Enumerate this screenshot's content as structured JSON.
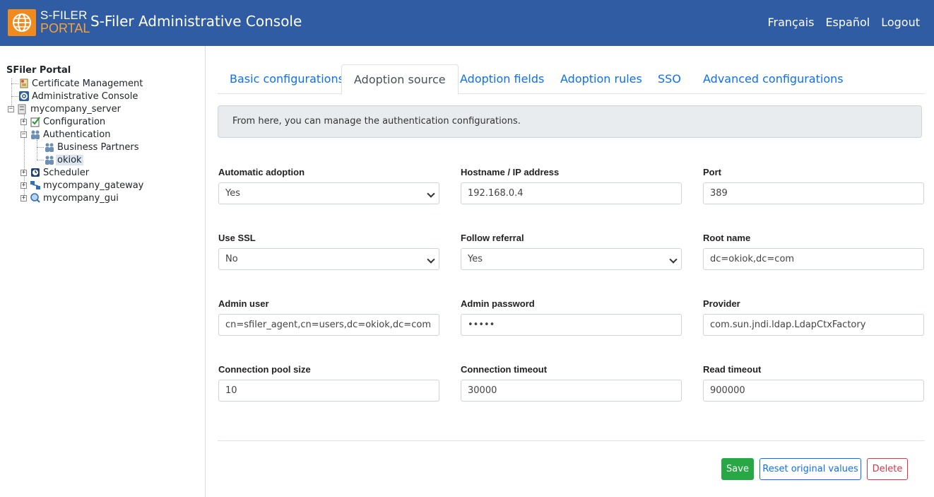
{
  "header": {
    "logo_line1": "S-FILER",
    "logo_line2": "PORTAL",
    "title": "S-Filer Administrative Console",
    "links": [
      "Français",
      "Español",
      "Logout"
    ]
  },
  "tree": {
    "root": "SFiler Portal",
    "items": [
      {
        "label": "Certificate Management"
      },
      {
        "label": "Administrative Console"
      },
      {
        "label": "mycompany_server"
      },
      {
        "label": "Configuration"
      },
      {
        "label": "Authentication"
      },
      {
        "label": "Business Partners"
      },
      {
        "label": "okiok"
      },
      {
        "label": "Scheduler"
      },
      {
        "label": "mycompany_gateway"
      },
      {
        "label": "mycompany_gui"
      }
    ]
  },
  "tabs": [
    {
      "label": "Basic configurations"
    },
    {
      "label": "Adoption source"
    },
    {
      "label": "Adoption fields"
    },
    {
      "label": "Adoption rules"
    },
    {
      "label": "SSO"
    },
    {
      "label": "Advanced configurations"
    }
  ],
  "info": "From here, you can manage the authentication configurations.",
  "form": {
    "automatic_adoption": {
      "label": "Automatic adoption",
      "value": "Yes"
    },
    "hostname": {
      "label": "Hostname / IP address",
      "value": "192.168.0.4"
    },
    "port": {
      "label": "Port",
      "value": "389"
    },
    "use_ssl": {
      "label": "Use SSL",
      "value": "No"
    },
    "follow_referral": {
      "label": "Follow referral",
      "value": "Yes"
    },
    "root_name": {
      "label": "Root name",
      "value": "dc=okiok,dc=com"
    },
    "admin_user": {
      "label": "Admin user",
      "value": "cn=sfiler_agent,cn=users,dc=okiok,dc=com"
    },
    "admin_password": {
      "label": "Admin password",
      "value": "•••••"
    },
    "provider": {
      "label": "Provider",
      "value": "com.sun.jndi.ldap.LdapCtxFactory"
    },
    "pool_size": {
      "label": "Connection pool size",
      "value": "10"
    },
    "conn_timeout": {
      "label": "Connection timeout",
      "value": "30000"
    },
    "read_timeout": {
      "label": "Read timeout",
      "value": "900000"
    }
  },
  "buttons": {
    "save": "Save",
    "reset": "Reset original values",
    "delete": "Delete"
  },
  "colors": {
    "header": "#2f5ca2",
    "logo_orange": "#f08a1c",
    "link_blue": "#0d6efd",
    "save_green": "#28a745",
    "delete_red": "#dc3545"
  }
}
